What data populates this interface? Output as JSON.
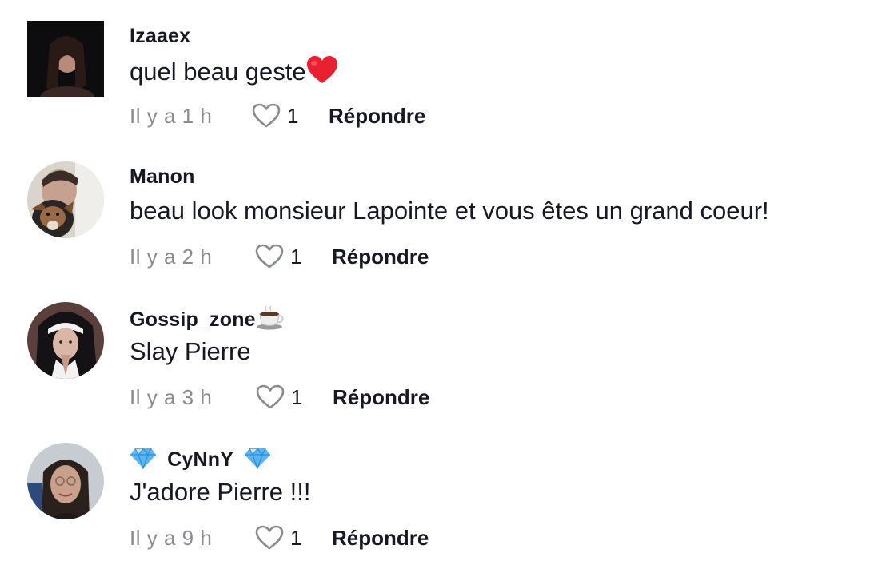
{
  "comments": [
    {
      "username": "Izaaex",
      "text": "quel beau geste",
      "text_emoji": "red-heart",
      "time": "Il y a 1 h",
      "likes": "1",
      "reply_label": "Répondre"
    },
    {
      "username": "Manon",
      "text": "beau look monsieur Lapointe et vous êtes un grand coeur!",
      "time": "Il y a 2 h",
      "likes": "1",
      "reply_label": "Répondre"
    },
    {
      "username": "Gossip_zone",
      "username_emoji": "coffee-cup",
      "text": "Slay Pierre",
      "time": "Il y a 3 h",
      "likes": "1",
      "reply_label": "Répondre"
    },
    {
      "username": "CyNnY",
      "username_emoji": "gem-stone",
      "text": "J'adore Pierre !!!",
      "time": "Il y a 9 h",
      "likes": "1",
      "reply_label": "Répondre"
    }
  ],
  "colors": {
    "text": "#161823",
    "secondary": "#8a8b91",
    "heart": "#e8202f",
    "gem": "#5ab4f0"
  }
}
